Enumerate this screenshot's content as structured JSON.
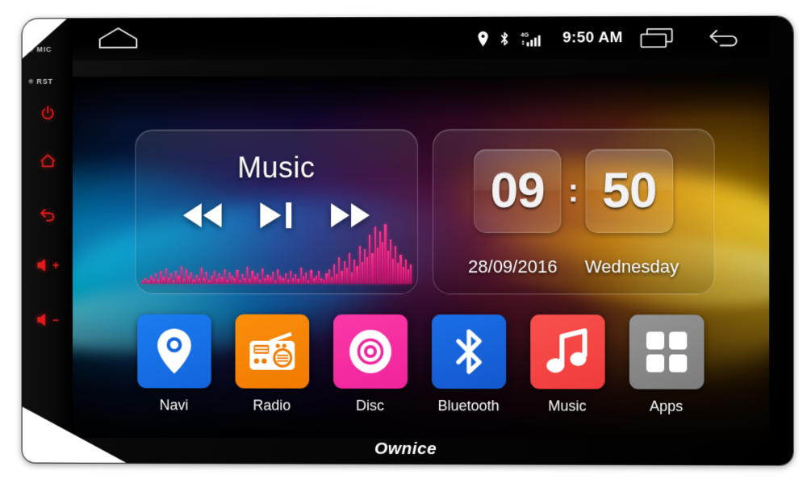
{
  "device": {
    "brand": "Ownice",
    "bezel": {
      "indicators": [
        {
          "label": "MIC",
          "name": "mic-indicator"
        },
        {
          "label": "RST",
          "name": "reset-indicator"
        }
      ],
      "buttons": [
        {
          "name": "power-button",
          "icon": "power-icon",
          "label": "Power"
        },
        {
          "name": "home-button",
          "icon": "home-icon",
          "label": "Home"
        },
        {
          "name": "back-button",
          "icon": "back-arrow-icon",
          "label": "Back"
        },
        {
          "name": "volume-up-button",
          "icon": "volume-up-icon",
          "label": "Volume Up",
          "sign": "+"
        },
        {
          "name": "volume-down-button",
          "icon": "volume-down-icon",
          "label": "Volume Down",
          "sign": "–"
        }
      ]
    }
  },
  "status_bar": {
    "home_icon": "home-outline-icon",
    "location_icon": "location-pin-icon",
    "bluetooth_icon": "bluetooth-icon",
    "signal_icon": "signal-bars-icon",
    "network_label": "4G",
    "clock": "9:50 AM",
    "recents_icon": "recent-apps-icon",
    "back_icon": "back-arrow-icon"
  },
  "widgets": {
    "music": {
      "title": "Music",
      "controls": [
        {
          "name": "previous-track-button",
          "icon": "rewind-icon"
        },
        {
          "name": "play-pause-button",
          "icon": "play-pause-icon"
        },
        {
          "name": "next-track-button",
          "icon": "fast-forward-icon"
        }
      ],
      "visualizer_color": "#ff2f87",
      "visualizer_levels": [
        6,
        10,
        5,
        14,
        8,
        18,
        7,
        22,
        11,
        26,
        9,
        17,
        6,
        21,
        13,
        30,
        8,
        24,
        12,
        19,
        7,
        15,
        10,
        27,
        9,
        20,
        6,
        13,
        22,
        8,
        17,
        11,
        25,
        7,
        19,
        14,
        9,
        23,
        6,
        16,
        10,
        28,
        8,
        21,
        12,
        18,
        7,
        26,
        9,
        15,
        11,
        20,
        6,
        24,
        13,
        9,
        17,
        7,
        22,
        10,
        16,
        8,
        27,
        12,
        19,
        6,
        23,
        9,
        14,
        21,
        10,
        7,
        18,
        25,
        11,
        32,
        16,
        45,
        22,
        38,
        27,
        52,
        19,
        41,
        30,
        64,
        36,
        58,
        44,
        82,
        52,
        96,
        61,
        88,
        70,
        100,
        55,
        74,
        42,
        63,
        35,
        48,
        29,
        40,
        24,
        33
      ]
    },
    "clock": {
      "hours": "09",
      "separator": ":",
      "minutes": "50",
      "date": "28/09/2016",
      "weekday": "Wednesday"
    }
  },
  "dock": {
    "apps": [
      {
        "label": "Navi",
        "icon": "map-pin-icon",
        "color": "#1464dc",
        "color2": "#1a7cf0"
      },
      {
        "label": "Radio",
        "icon": "radio-icon",
        "color": "#f07a00",
        "color2": "#fb8e0a"
      },
      {
        "label": "Disc",
        "icon": "disc-icon",
        "color": "#f0239b",
        "color2": "#fb38a8"
      },
      {
        "label": "Bluetooth",
        "icon": "bluetooth-icon",
        "color": "#1358cc",
        "color2": "#1a6ee8"
      },
      {
        "label": "Music",
        "icon": "music-note-icon",
        "color": "#ef3b3b",
        "color2": "#f9514d"
      },
      {
        "label": "Apps",
        "icon": "app-grid-icon",
        "color": "#7c7c7c",
        "color2": "#949494"
      }
    ]
  }
}
